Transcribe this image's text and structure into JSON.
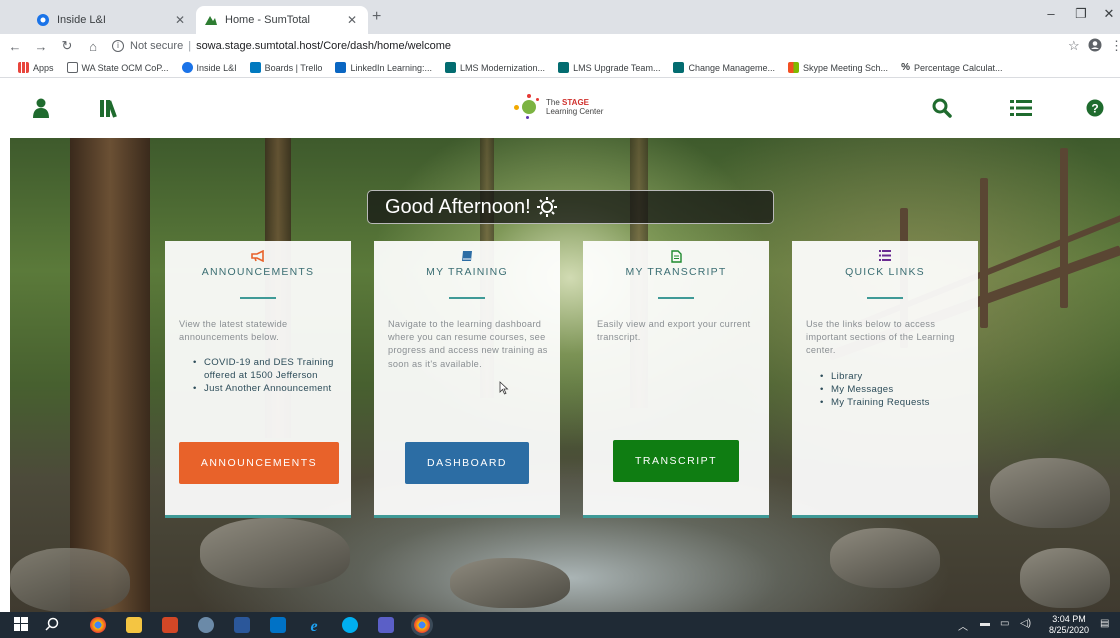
{
  "browser": {
    "tabs": [
      {
        "title": "Inside L&I",
        "active": false
      },
      {
        "title": "Home - SumTotal",
        "active": true
      }
    ],
    "address": {
      "security_label": "Not secure",
      "url": "sowa.stage.sumtotal.host/Core/dash/home/welcome"
    },
    "bookmarks": [
      {
        "label": "Apps",
        "icon": "apps-grid-icon",
        "color": "#e8453c"
      },
      {
        "label": "WA State OCM CoP...",
        "icon": "document-icon",
        "color": "#5f6368"
      },
      {
        "label": "Inside L&I",
        "icon": "inside-li-icon",
        "color": "#1a73e8"
      },
      {
        "label": "Boards | Trello",
        "icon": "trello-icon",
        "color": "#0079bf"
      },
      {
        "label": "LinkedIn Learning:...",
        "icon": "linkedin-icon",
        "color": "#0a66c2"
      },
      {
        "label": "LMS Modernization...",
        "icon": "sharepoint-icon",
        "color": "#036c70"
      },
      {
        "label": "LMS Upgrade Team...",
        "icon": "sharepoint-icon",
        "color": "#036c70"
      },
      {
        "label": "Change Manageme...",
        "icon": "sharepoint-icon",
        "color": "#036c70"
      },
      {
        "label": "Skype Meeting Sch...",
        "icon": "microsoft-icon",
        "color": "#f25022"
      },
      {
        "label": "Percentage Calculat...",
        "icon": "percent-icon",
        "color": "#000000"
      }
    ]
  },
  "site": {
    "logo": {
      "line1_prefix": "The",
      "line1_brand": "STAGE",
      "line2": "Learning Center"
    },
    "greeting": "Good Afternoon!",
    "cards": [
      {
        "title": "ANNOUNCEMENTS",
        "icon": "megaphone-icon",
        "icon_color": "#e8622a",
        "description": "View the latest statewide announcements below.",
        "list": [
          "COVID-19 and DES Training offered at 1500 Jefferson",
          "Just Another Announcement"
        ],
        "button": "ANNOUNCEMENTS",
        "button_color": "#e8622a"
      },
      {
        "title": "MY TRAINING",
        "icon": "book-icon",
        "icon_color": "#2c6da4",
        "description": "Navigate to the learning dashboard where you can resume courses, see progress and access new training as soon as it's available.",
        "list": [],
        "button": "DASHBOARD",
        "button_color": "#2c6da4"
      },
      {
        "title": "MY TRANSCRIPT",
        "icon": "file-text-icon",
        "icon_color": "#1e8a2e",
        "description": "Easily view and export your current transcript.",
        "list": [],
        "button": "TRANSCRIPT",
        "button_color": "#0f7d12"
      },
      {
        "title": "QUICK LINKS",
        "icon": "list-icon",
        "icon_color": "#6a2c91",
        "description": "Use the links below to access important sections of the Learning center.",
        "list": [
          "Library",
          "My Messages",
          "My Training Requests"
        ],
        "button": "",
        "button_color": ""
      }
    ]
  },
  "taskbar": {
    "time": "3:04 PM",
    "date": "8/25/2020"
  }
}
